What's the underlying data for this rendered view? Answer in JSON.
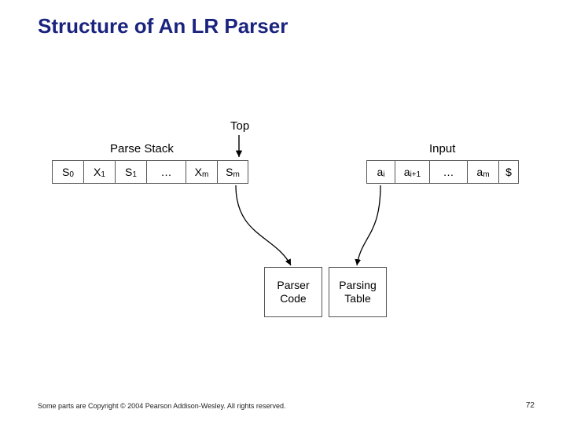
{
  "title": "Structure of An LR Parser",
  "labels": {
    "parseStack": "Parse Stack",
    "top": "Top",
    "input": "Input"
  },
  "stackCells": [
    {
      "base": "S",
      "sub": "0"
    },
    {
      "base": "X",
      "sub": "1"
    },
    {
      "base": "S",
      "sub": "1"
    },
    {
      "base": "…",
      "sub": ""
    },
    {
      "base": "X",
      "sub": "m"
    },
    {
      "base": "S",
      "sub": "m"
    }
  ],
  "inputCells": [
    {
      "base": "a",
      "sub": "i"
    },
    {
      "base": "a",
      "sub": "i+1"
    },
    {
      "base": "…",
      "sub": ""
    },
    {
      "base": "a",
      "sub": "m"
    },
    {
      "base": "$",
      "sub": ""
    }
  ],
  "boxes": {
    "parserCode": "Parser\nCode",
    "parsingTable": "Parsing\nTable"
  },
  "footer": "Some parts are Copyright © 2004 Pearson Addison-Wesley. All rights reserved.",
  "page": "72"
}
